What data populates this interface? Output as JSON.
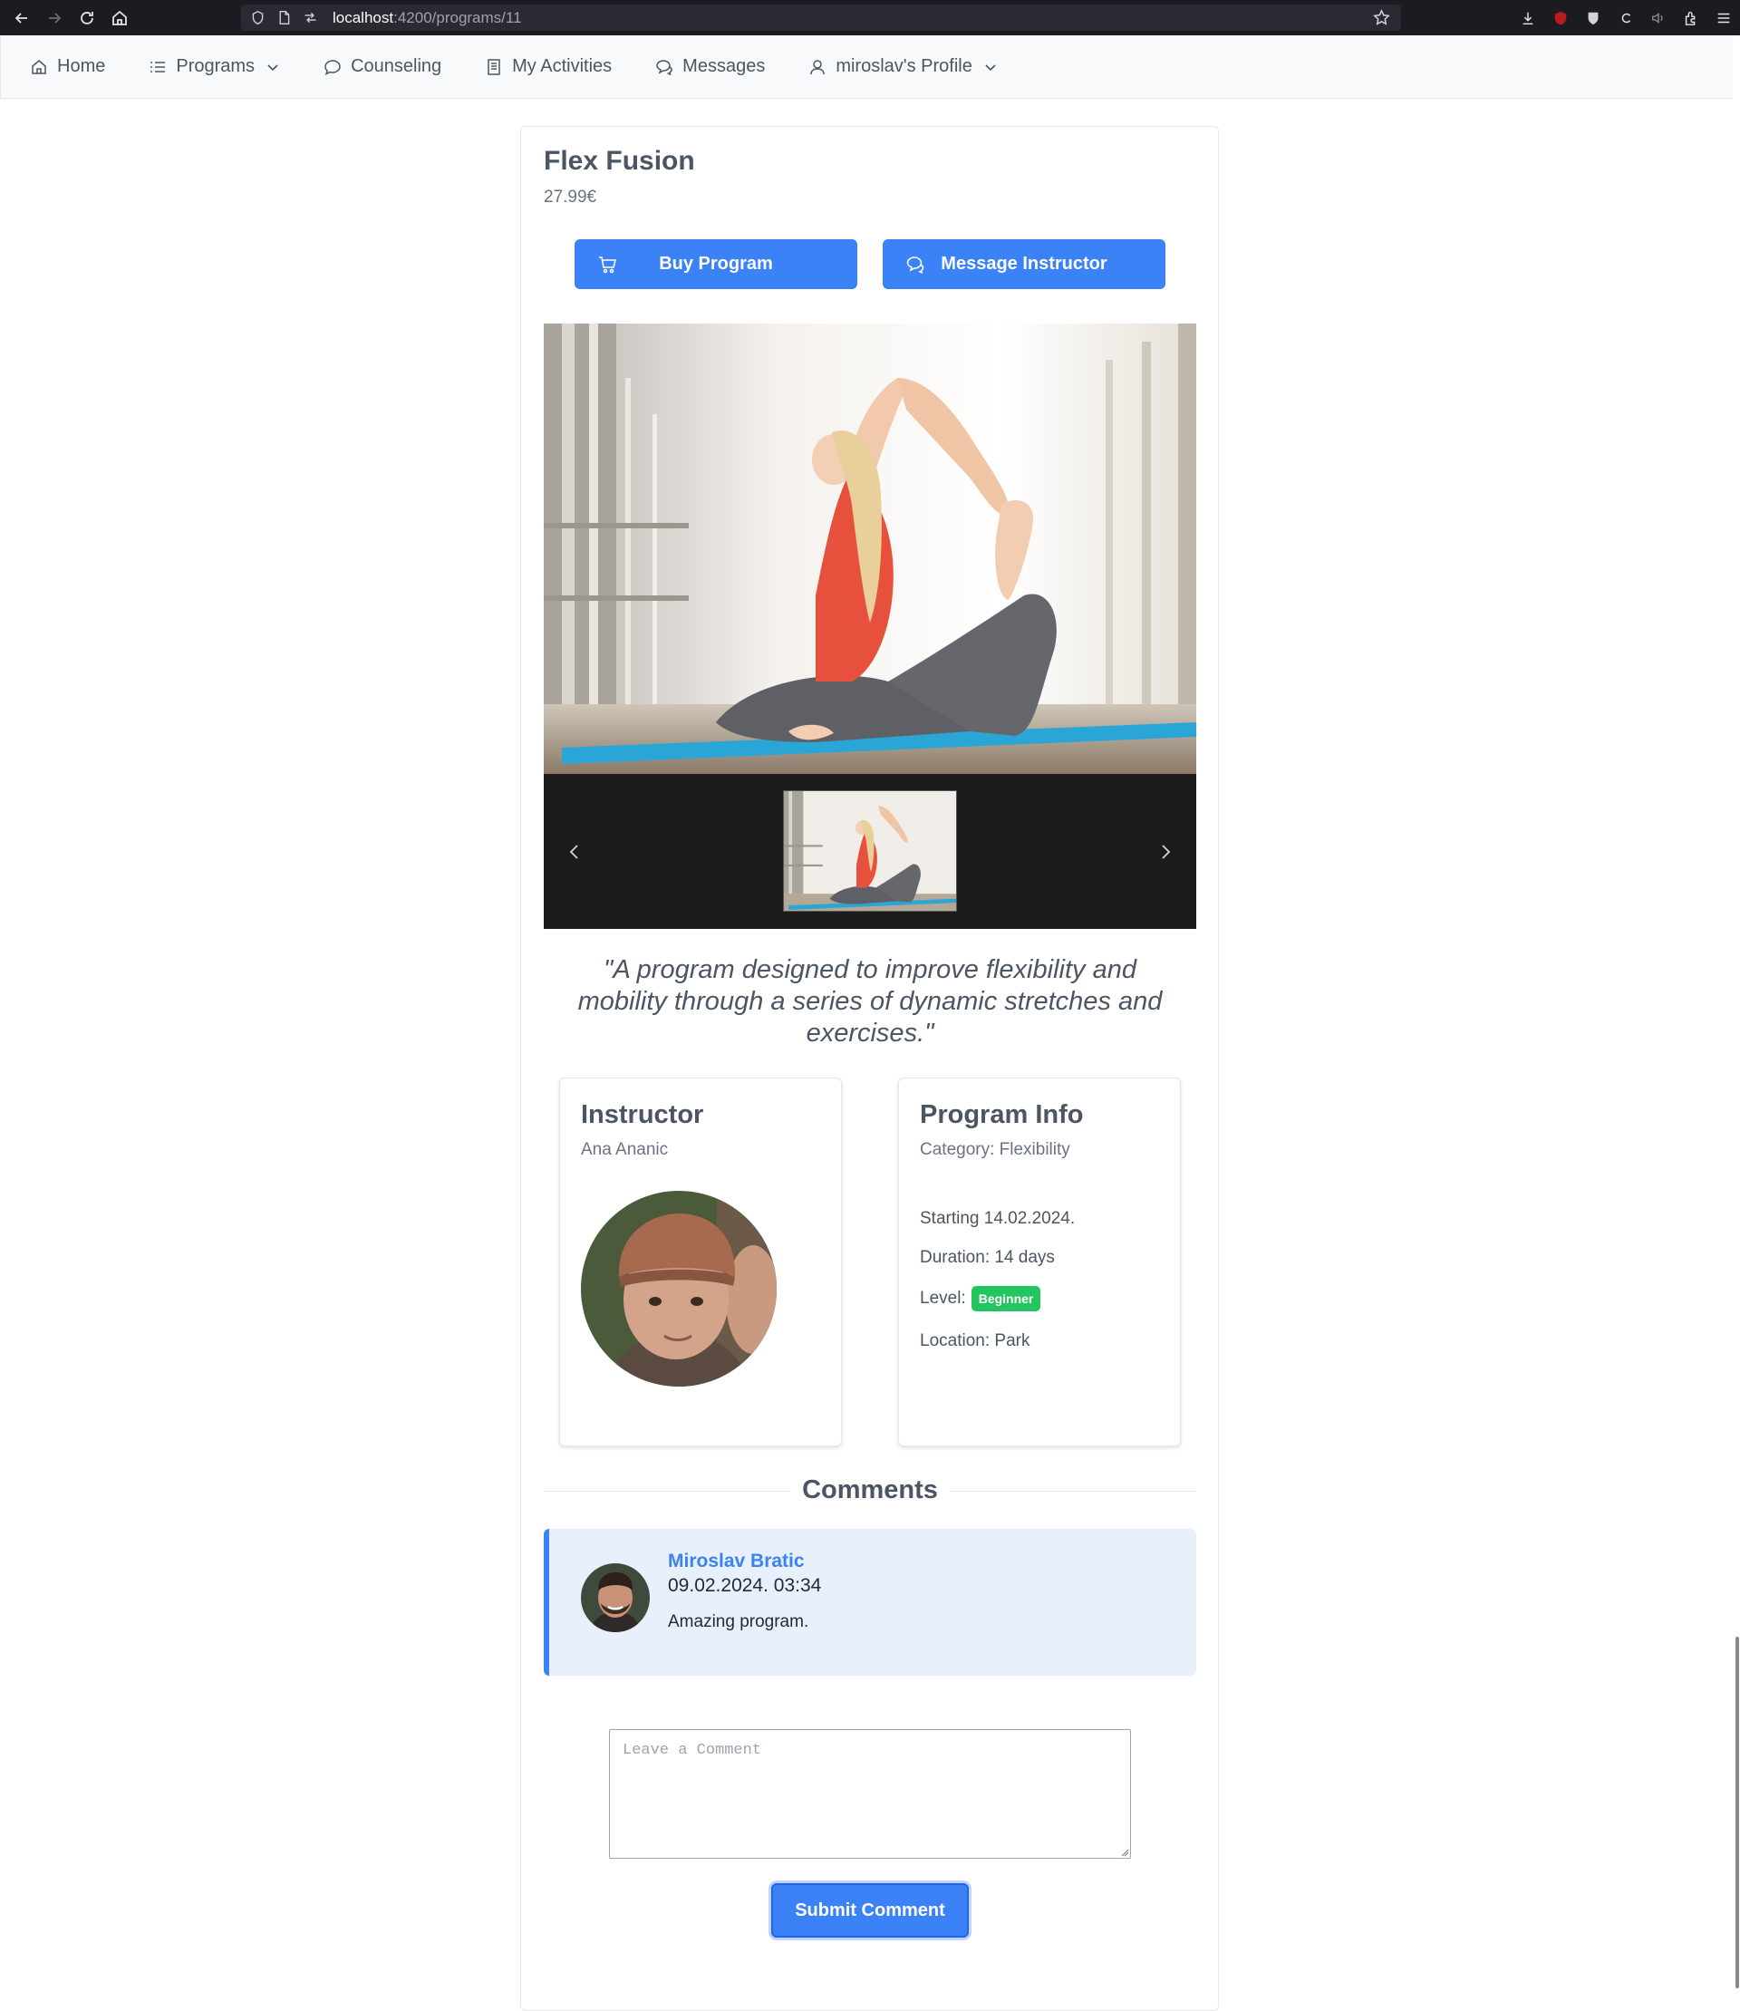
{
  "browser": {
    "url_host": "localhost",
    "url_path": ":4200/programs/11"
  },
  "nav": {
    "home": "Home",
    "programs": "Programs",
    "counseling": "Counseling",
    "activities": "My Activities",
    "messages": "Messages",
    "profile": "miroslav's Profile"
  },
  "program": {
    "title": "Flex Fusion",
    "price": "27.99€",
    "buy_label": "Buy Program",
    "message_label": "Message Instructor",
    "description": "\"A program designed to improve flexibility and mobility through a series of dynamic stretches and exercises.\""
  },
  "instructor": {
    "heading": "Instructor",
    "name": "Ana Ananic"
  },
  "info": {
    "heading": "Program Info",
    "category": "Category: Flexibility",
    "starting": "Starting 14.02.2024.",
    "duration": "Duration: 14 days",
    "level_label": "Level:",
    "level": "Beginner",
    "location": "Location: Park"
  },
  "comments": {
    "heading": "Comments",
    "items": [
      {
        "author": "Miroslav Bratic",
        "date": "09.02.2024. 03:34",
        "text": "Amazing program."
      }
    ],
    "placeholder": "Leave a Comment",
    "submit_label": "Submit Comment"
  },
  "colors": {
    "primary": "#3b82f6",
    "badge_success": "#22c55e",
    "comment_bg": "#e8f0fb"
  }
}
